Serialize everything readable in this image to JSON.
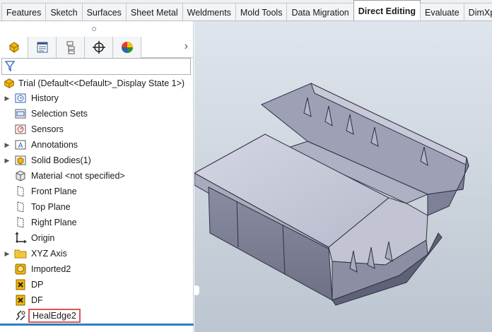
{
  "tabs": [
    {
      "label": "Features",
      "active": false
    },
    {
      "label": "Sketch",
      "active": false
    },
    {
      "label": "Surfaces",
      "active": false
    },
    {
      "label": "Sheet Metal",
      "active": false
    },
    {
      "label": "Weldments",
      "active": false
    },
    {
      "label": "Mold Tools",
      "active": false
    },
    {
      "label": "Data Migration",
      "active": false
    },
    {
      "label": "Direct Editing",
      "active": true
    },
    {
      "label": "Evaluate",
      "active": false
    },
    {
      "label": "DimXpe",
      "active": false
    }
  ],
  "manager_tabs": [
    "feature-manager-icon",
    "property-manager-icon",
    "configuration-manager-icon",
    "dimxpert-manager-icon",
    "display-manager-icon"
  ],
  "tree": {
    "root_label": "Trial  (Default<<Default>_Display State 1>)",
    "items": [
      {
        "label": "History",
        "icon": "history-icon",
        "expandable": true
      },
      {
        "label": "Selection Sets",
        "icon": "selection-sets-icon",
        "expandable": false
      },
      {
        "label": "Sensors",
        "icon": "sensors-icon",
        "expandable": false
      },
      {
        "label": "Annotations",
        "icon": "annotations-icon",
        "expandable": true
      },
      {
        "label": "Solid Bodies(1)",
        "icon": "solid-bodies-icon",
        "expandable": true
      },
      {
        "label": "Material <not specified>",
        "icon": "material-icon",
        "expandable": false
      },
      {
        "label": "Front Plane",
        "icon": "plane-icon",
        "expandable": false
      },
      {
        "label": "Top Plane",
        "icon": "plane-icon",
        "expandable": false
      },
      {
        "label": "Right Plane",
        "icon": "plane-icon",
        "expandable": false
      },
      {
        "label": "Origin",
        "icon": "origin-icon",
        "expandable": false
      },
      {
        "label": "XYZ Axis",
        "icon": "folder-icon",
        "expandable": true
      },
      {
        "label": "Imported2",
        "icon": "imported-body-icon",
        "expandable": false
      },
      {
        "label": "DP",
        "icon": "delete-face-icon",
        "expandable": false
      },
      {
        "label": "DF",
        "icon": "delete-face-icon",
        "expandable": false
      },
      {
        "label": "HealEdge2",
        "icon": "heal-edge-icon",
        "expandable": false,
        "highlighted": true
      }
    ]
  },
  "colors": {
    "highlight_border": "#e05356",
    "accent": "#2e7fc0",
    "part_icon": "#f0b400"
  }
}
